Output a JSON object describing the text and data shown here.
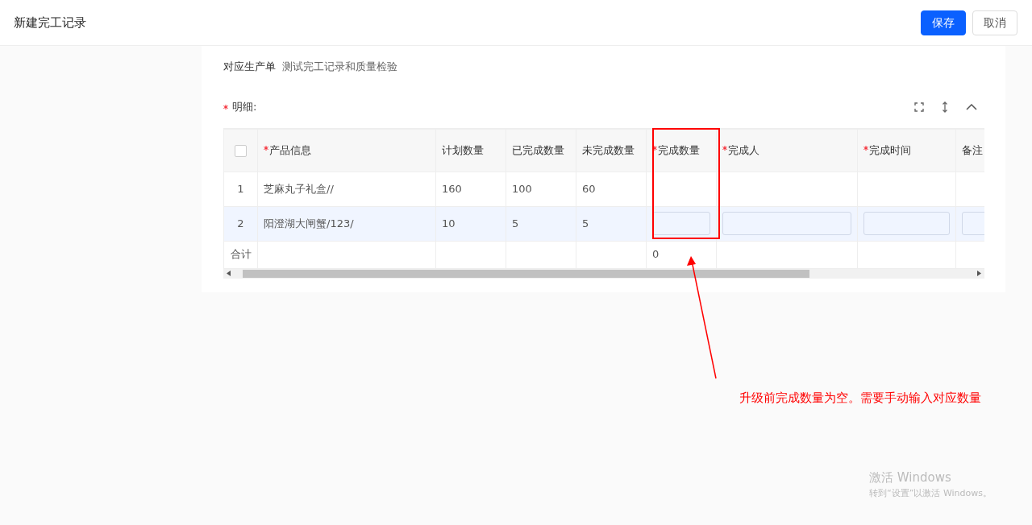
{
  "header": {
    "title": "新建完工记录",
    "buttons": [
      {
        "label": "保存",
        "kind": "primary"
      },
      {
        "label": "取消",
        "kind": "default"
      }
    ]
  },
  "form": {
    "order_label": "对应生产单",
    "order_value": "测试完工记录和质量检验"
  },
  "detail": {
    "label": "明细:",
    "required": true
  },
  "table": {
    "select_all": {
      "checked": false
    },
    "columns": [
      {
        "label": "产品信息",
        "required": true,
        "kind": "text"
      },
      {
        "label": "计划数量",
        "required": false,
        "kind": "text"
      },
      {
        "label": "已完成数量",
        "required": false,
        "kind": "text"
      },
      {
        "label": "未完成数量",
        "required": false,
        "kind": "text"
      },
      {
        "label": "完成数量",
        "required": true,
        "kind": "input"
      },
      {
        "label": "完成人",
        "required": true,
        "kind": "input"
      },
      {
        "label": "完成时间",
        "required": true,
        "kind": "input"
      },
      {
        "label": "备注",
        "required": false,
        "kind": "input"
      }
    ],
    "rows": [
      {
        "index": "1",
        "cells": [
          "芝麻丸子礼盒//",
          "160",
          "100",
          "60"
        ],
        "editing": false
      },
      {
        "index": "2",
        "cells": [
          "阳澄湖大闸蟹/123/",
          "10",
          "5",
          "5"
        ],
        "editing": true
      }
    ],
    "footer": {
      "label": "合计",
      "total": "0"
    }
  },
  "annotation": {
    "text": "升级前完成数量为空。需要手动输入对应数量"
  },
  "watermark": {
    "title": "激活 Windows",
    "subtitle": "转到“设置”以激活 Windows。"
  }
}
